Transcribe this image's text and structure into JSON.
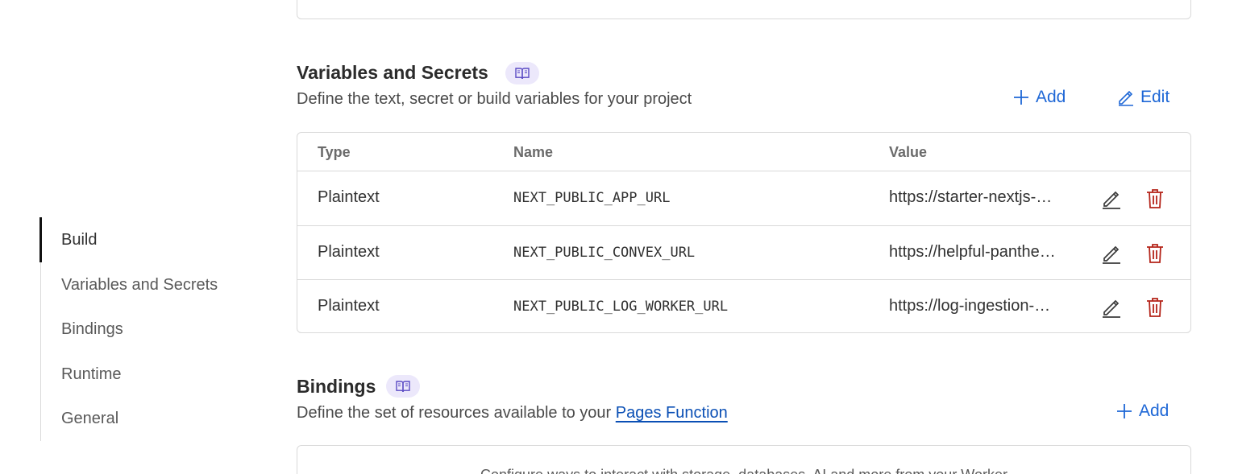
{
  "sidebar": {
    "items": [
      {
        "label": "Build",
        "active": true
      },
      {
        "label": "Variables and Secrets",
        "active": false
      },
      {
        "label": "Bindings",
        "active": false
      },
      {
        "label": "Runtime",
        "active": false
      },
      {
        "label": "General",
        "active": false
      }
    ]
  },
  "variables_section": {
    "title": "Variables and Secrets",
    "description": "Define the text, secret or build variables for your project",
    "add_label": "Add",
    "edit_label": "Edit",
    "columns": [
      "Type",
      "Name",
      "Value"
    ],
    "rows": [
      {
        "type": "Plaintext",
        "name": "NEXT_PUBLIC_APP_URL",
        "value": "https://starter-nextjs-…"
      },
      {
        "type": "Plaintext",
        "name": "NEXT_PUBLIC_CONVEX_URL",
        "value": "https://helpful-panthe…"
      },
      {
        "type": "Plaintext",
        "name": "NEXT_PUBLIC_LOG_WORKER_URL",
        "value": "https://log-ingestion-…"
      }
    ]
  },
  "bindings_section": {
    "title": "Bindings",
    "description_prefix": "Define the set of resources available to your",
    "description_link": "Pages Function",
    "add_label": "Add",
    "hint": "Configure ways to interact with storage, databases, AI and more from your Worker"
  },
  "colors": {
    "accent": "#1e67d6",
    "danger": "#b42318",
    "docs_pill_bg": "#ece8fb",
    "docs_pill_icon": "#5b4bc4",
    "border": "#d9d9d9"
  },
  "icons": {
    "docs": "book-open-icon",
    "add": "plus-icon",
    "edit": "pencil-icon",
    "delete": "trash-icon"
  }
}
